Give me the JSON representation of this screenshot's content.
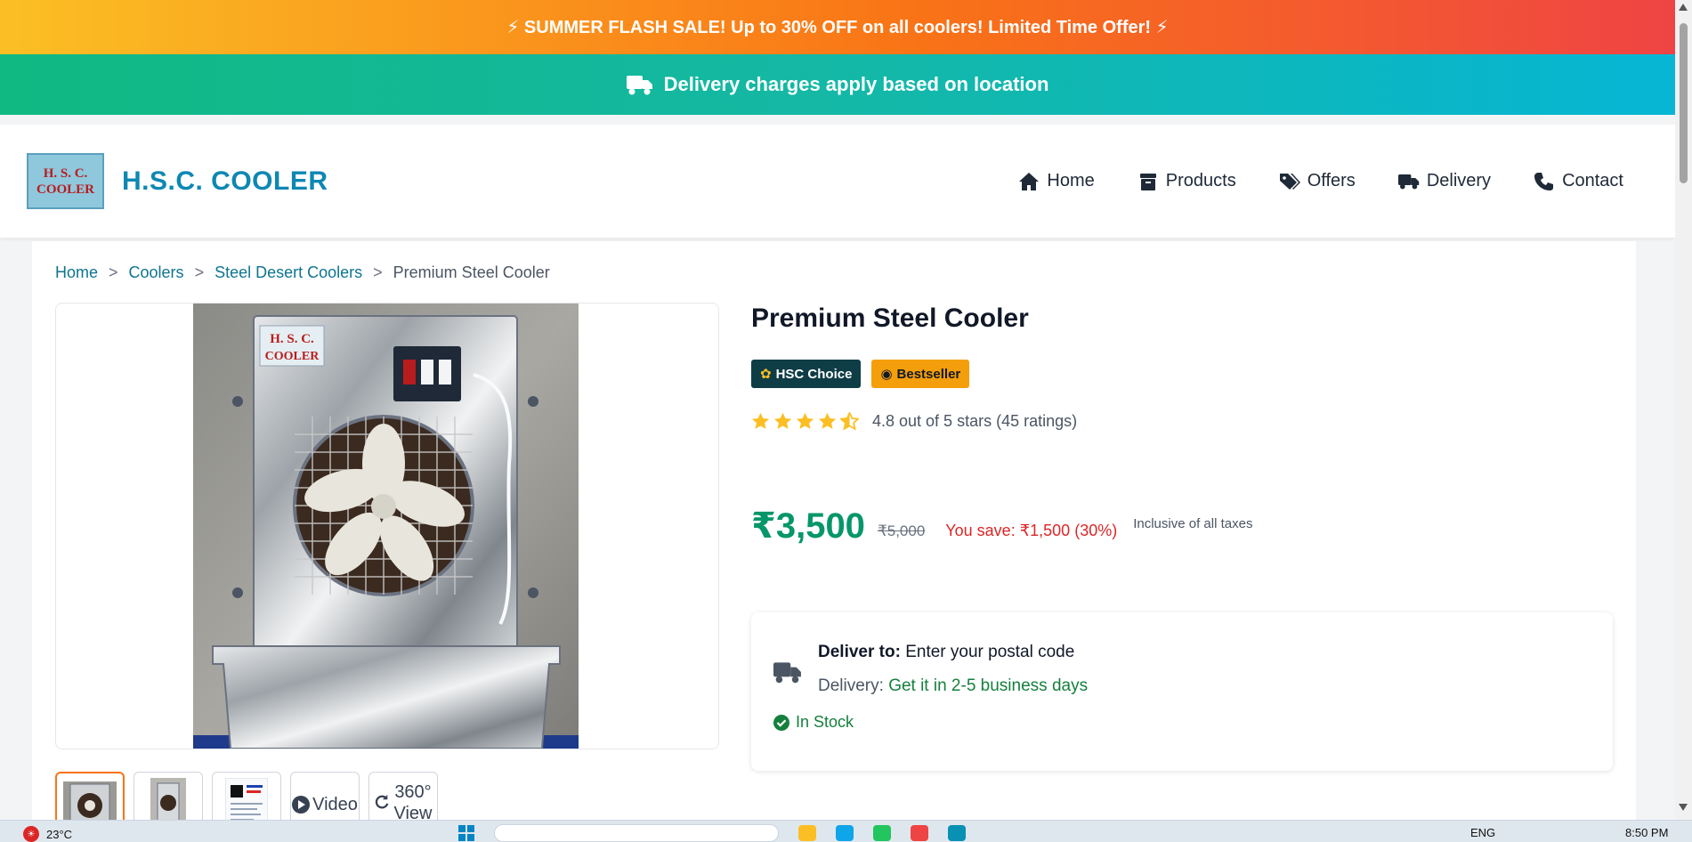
{
  "banner": {
    "flash_sale": "⚡ SUMMER FLASH SALE! Up to 30% OFF on all coolers! Limited Time Offer! ⚡",
    "delivery": "Delivery charges apply based on location"
  },
  "header": {
    "logo_line1": "H. S. C.",
    "logo_line2": "COOLER",
    "brand": "H.S.C. COOLER",
    "nav": [
      {
        "label": "Home",
        "icon": "home-icon"
      },
      {
        "label": "Products",
        "icon": "box-icon"
      },
      {
        "label": "Offers",
        "icon": "tags-icon"
      },
      {
        "label": "Delivery",
        "icon": "truck-icon"
      },
      {
        "label": "Contact",
        "icon": "phone-icon"
      }
    ]
  },
  "breadcrumb": [
    "Home",
    "Coolers",
    "Steel Desert Coolers",
    "Premium Steel Cooler"
  ],
  "breadcrumb_separator": ">",
  "gallery": {
    "photo_logo_line1": "H. S. C.",
    "photo_logo_line2": "COOLER",
    "thumbs": [
      "photo",
      "photo",
      "photo",
      "Video",
      "360° View"
    ]
  },
  "product": {
    "title": "Premium Steel Cooler",
    "badges": [
      "HSC Choice",
      "Bestseller"
    ],
    "rating": 4.8,
    "rating_text": "4.8 out of 5 stars (45 ratings)",
    "price": "₹3,500",
    "mrp": "₹5,000",
    "savings": "You save: ₹1,500 (30%)",
    "tax_note": "Inclusive of all taxes"
  },
  "delivery": {
    "deliver_to_label": "Deliver to:",
    "deliver_to_value": "Enter your postal code",
    "delivery_label": "Delivery:",
    "delivery_value": "Get it in 2-5 business days",
    "stock": "In Stock"
  },
  "taskbar": {
    "weather": "23°C",
    "lang": "ENG",
    "time": "8:50 PM"
  },
  "colors": {
    "brand": "#0e87b3",
    "price": "#059669",
    "savings": "#dc2626",
    "in_stock": "#15803d",
    "star": "#fbbf24"
  }
}
